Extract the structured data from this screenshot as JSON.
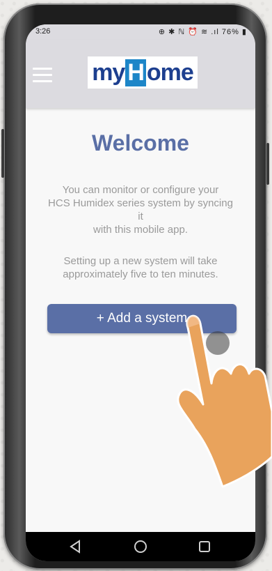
{
  "status_bar": {
    "time": "3:26",
    "icons": "⊕ ✱ ℕ ⏰ ≋ .ıl 76% ▮"
  },
  "header": {
    "menu_icon": "hamburger-menu-icon",
    "logo": {
      "my": "my",
      "h": "H",
      "rest": "ome"
    }
  },
  "main": {
    "title": "Welcome",
    "description_lines": [
      "You can monitor or configure your",
      "HCS Humidex series system by syncing",
      "it",
      "with this mobile app."
    ],
    "setup_lines": [
      "Setting up a new system will take",
      "approximately five to ten minutes."
    ],
    "add_button_label": "+ Add a system"
  },
  "colors": {
    "accent": "#5a6fa6",
    "header_bg": "#dcdbe0",
    "text_muted": "#9a9a9a",
    "logo_blue": "#1d3f8f",
    "logo_light_blue": "#1d86c8",
    "hand": "#e9a35c"
  },
  "nav_bar": {
    "back_icon": "back-triangle-icon",
    "home_icon": "home-circle-icon",
    "recents_icon": "recents-square-icon"
  }
}
